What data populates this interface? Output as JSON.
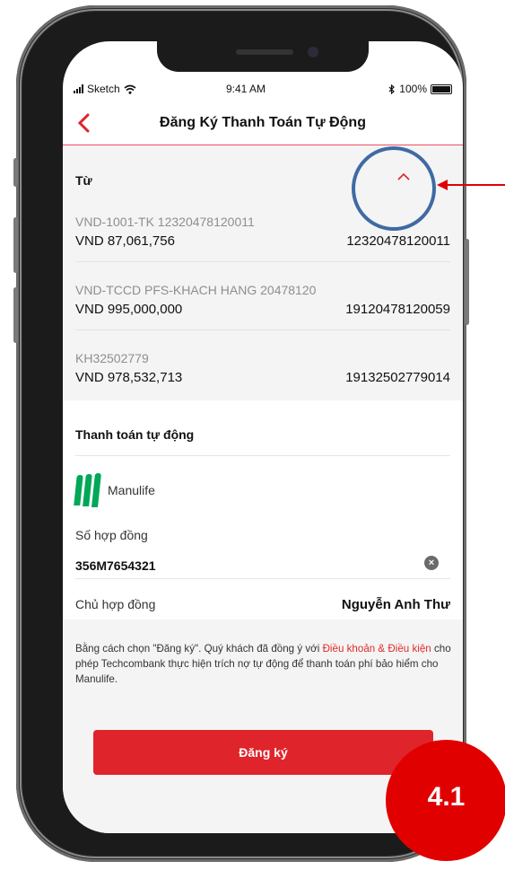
{
  "status_bar": {
    "carrier": "Sketch",
    "time": "9:41 AM",
    "battery": "100%"
  },
  "header": {
    "title": "Đăng Ký Thanh Toán Tự Động"
  },
  "from_section": {
    "label": "Từ",
    "accounts": [
      {
        "name": "VND-1001-TK 12320478120011",
        "balance": "VND 87,061,756",
        "number": "12320478120011"
      },
      {
        "name": "VND-TCCD PFS-KHACH HANG 20478120",
        "balance": "VND 995,000,000",
        "number": "19120478120059"
      },
      {
        "name": "KH32502779",
        "balance": "VND 978,532,713",
        "number": "19132502779014"
      }
    ]
  },
  "auto_payment": {
    "title": "Thanh toán tự động",
    "provider": "Manulife",
    "contract_label": "Số hợp đồng",
    "contract_value": "356M7654321",
    "owner_label": "Chủ hợp đồng",
    "owner_value": "Nguyễn Anh Thư"
  },
  "terms": {
    "prefix": "Bằng cách chọn \"Đăng ký\". Quý khách đã đồng ý với ",
    "link": "Điều khoản & Điều kiện",
    "suffix": " cho phép Techcombank thực hiện trích nợ tự động để thanh toán phí bảo hiểm cho Manulife."
  },
  "register_label": "Đăng ký",
  "step_badge": "4.1",
  "colors": {
    "accent_red": "#e0242b",
    "annotation_blue": "#3f6aa3",
    "manulife_green": "#00a758"
  }
}
